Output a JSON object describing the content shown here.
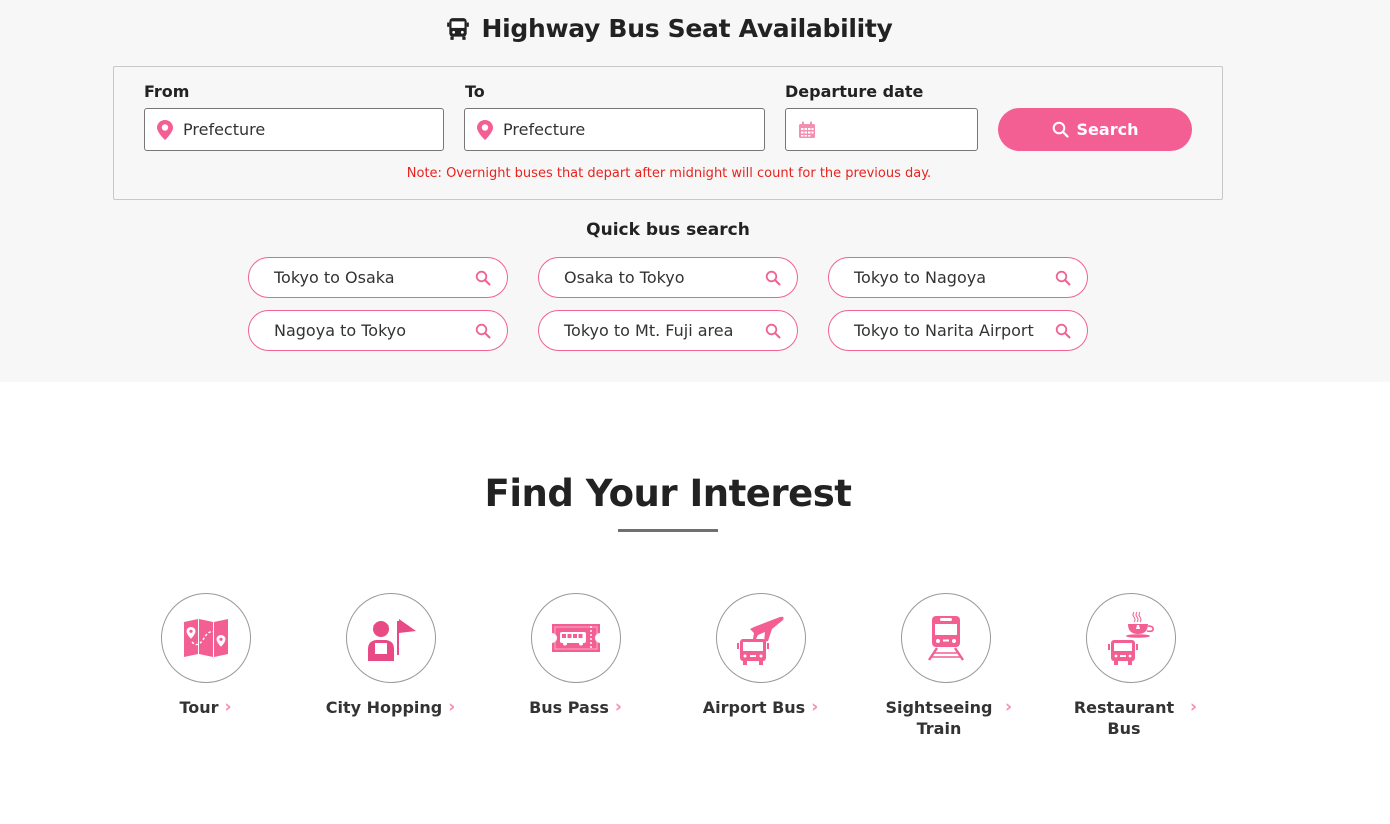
{
  "header": {
    "title": "Highway Bus Seat Availability",
    "icon": "bus-icon"
  },
  "search_form": {
    "from": {
      "label": "From",
      "placeholder": "Prefecture",
      "icon": "map-pin-icon"
    },
    "to": {
      "label": "To",
      "placeholder": "Prefecture",
      "icon": "map-pin-icon"
    },
    "departure": {
      "label": "Departure date",
      "value": "",
      "icon": "calendar-icon"
    },
    "search_button": {
      "label": "Search",
      "icon": "search-icon"
    },
    "note": "Note: Overnight buses that depart after midnight will count for the previous day."
  },
  "quick_search": {
    "title": "Quick bus search",
    "items": [
      {
        "label": "Tokyo to Osaka"
      },
      {
        "label": "Osaka to Tokyo"
      },
      {
        "label": "Tokyo to Nagoya"
      },
      {
        "label": "Nagoya to Tokyo"
      },
      {
        "label": "Tokyo to Mt. Fuji area"
      },
      {
        "label": "Tokyo to Narita Airport"
      }
    ]
  },
  "interests": {
    "title": "Find Your Interest",
    "items": [
      {
        "label": "Tour",
        "icon": "map-icon"
      },
      {
        "label": "City Hopping",
        "icon": "tour-guide-icon"
      },
      {
        "label": "Bus Pass",
        "icon": "bus-ticket-icon"
      },
      {
        "label": "Airport Bus",
        "icon": "airport-bus-icon"
      },
      {
        "label": "Sightseeing Train",
        "icon": "train-icon"
      },
      {
        "label": "Restaurant Bus",
        "icon": "restaurant-bus-icon"
      }
    ]
  },
  "colors": {
    "accent": "#f45f93",
    "note": "#e8231f",
    "band_bg": "#f7f7f7"
  }
}
